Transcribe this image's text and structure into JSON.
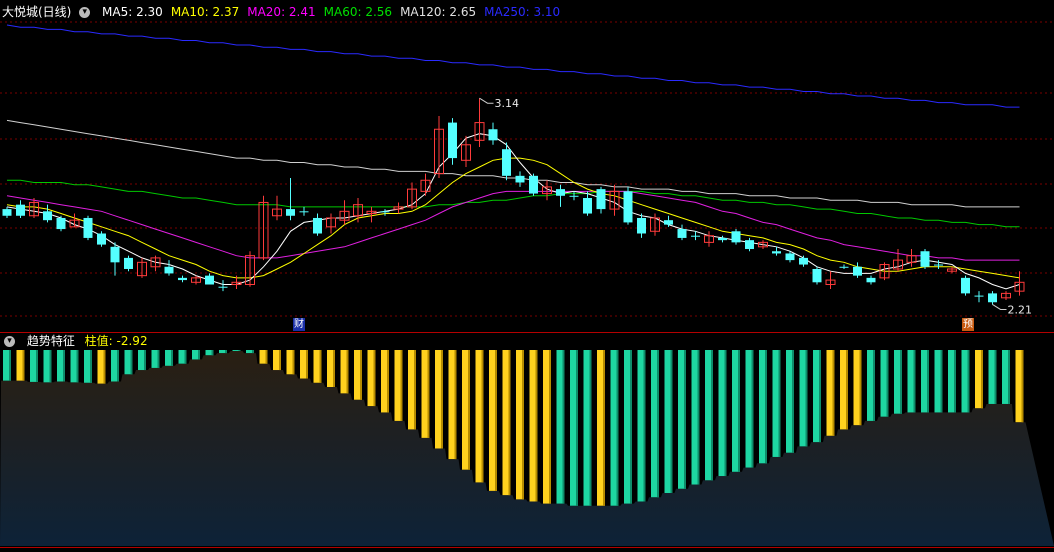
{
  "stock": {
    "title": "大悦城(日线)",
    "indicators": [
      {
        "label": "MA5: 2.30",
        "color": "#ffffff",
        "key": "ma5"
      },
      {
        "label": "MA10: 2.37",
        "color": "#ffff00",
        "key": "ma10"
      },
      {
        "label": "MA20: 2.41",
        "color": "#ff00ff",
        "key": "ma20"
      },
      {
        "label": "MA60: 2.56",
        "color": "#00e000",
        "key": "ma60"
      },
      {
        "label": "MA120: 2.65",
        "color": "#e0e0e0",
        "key": "ma120"
      },
      {
        "label": "MA250: 3.10",
        "color": "#2a2aff",
        "key": "ma250"
      }
    ],
    "high_label": "3.14",
    "low_label": "2.21",
    "badge_cai": "财",
    "badge_yu": "预"
  },
  "sub": {
    "title": "趋势特征",
    "value_label": "柱值: -2.92"
  },
  "chart_data": {
    "type": "candlestick",
    "y_range": [
      2.14,
      3.47
    ],
    "candles": [
      [
        2.64,
        2.61,
        2.65,
        2.6
      ],
      [
        2.66,
        2.61,
        2.68,
        2.6
      ],
      [
        2.61,
        2.67,
        2.69,
        2.6
      ],
      [
        2.63,
        2.59,
        2.66,
        2.58
      ],
      [
        2.6,
        2.55,
        2.61,
        2.54
      ],
      [
        2.56,
        2.59,
        2.62,
        2.56
      ],
      [
        2.6,
        2.51,
        2.61,
        2.5
      ],
      [
        2.53,
        2.48,
        2.54,
        2.47
      ],
      [
        2.47,
        2.4,
        2.49,
        2.34
      ],
      [
        2.42,
        2.37,
        2.43,
        2.36
      ],
      [
        2.34,
        2.4,
        2.42,
        2.33
      ],
      [
        2.38,
        2.42,
        2.43,
        2.36
      ],
      [
        2.38,
        2.35,
        2.41,
        2.34
      ],
      [
        2.33,
        2.32,
        2.34,
        2.31
      ],
      [
        2.31,
        2.33,
        2.34,
        2.3
      ],
      [
        2.34,
        2.3,
        2.35,
        2.3
      ],
      [
        2.29,
        2.29,
        2.32,
        2.27
      ],
      [
        2.3,
        2.31,
        2.34,
        2.28
      ],
      [
        2.3,
        2.43,
        2.45,
        2.29
      ],
      [
        2.42,
        2.67,
        2.7,
        2.41
      ],
      [
        2.61,
        2.64,
        2.7,
        2.59
      ],
      [
        2.64,
        2.61,
        2.78,
        2.59
      ],
      [
        2.63,
        2.63,
        2.65,
        2.61
      ],
      [
        2.6,
        2.53,
        2.62,
        2.52
      ],
      [
        2.56,
        2.6,
        2.62,
        2.53
      ],
      [
        2.59,
        2.63,
        2.68,
        2.57
      ],
      [
        2.61,
        2.66,
        2.69,
        2.58
      ],
      [
        2.62,
        2.63,
        2.65,
        2.58
      ],
      [
        2.63,
        2.63,
        2.64,
        2.61
      ],
      [
        2.64,
        2.65,
        2.67,
        2.62
      ],
      [
        2.65,
        2.73,
        2.76,
        2.64
      ],
      [
        2.72,
        2.77,
        2.8,
        2.7
      ],
      [
        2.8,
        3.0,
        3.06,
        2.78
      ],
      [
        3.03,
        2.87,
        3.05,
        2.84
      ],
      [
        2.86,
        2.93,
        2.97,
        2.83
      ],
      [
        2.95,
        3.03,
        3.14,
        2.92
      ],
      [
        3.0,
        2.95,
        3.03,
        2.93
      ],
      [
        2.91,
        2.79,
        2.94,
        2.77
      ],
      [
        2.79,
        2.76,
        2.81,
        2.74
      ],
      [
        2.79,
        2.71,
        2.8,
        2.7
      ],
      [
        2.71,
        2.74,
        2.77,
        2.68
      ],
      [
        2.73,
        2.7,
        2.75,
        2.65
      ],
      [
        2.7,
        2.7,
        2.72,
        2.68
      ],
      [
        2.69,
        2.62,
        2.72,
        2.61
      ],
      [
        2.73,
        2.64,
        2.74,
        2.62
      ],
      [
        2.64,
        2.72,
        2.75,
        2.61
      ],
      [
        2.72,
        2.58,
        2.74,
        2.57
      ],
      [
        2.6,
        2.53,
        2.62,
        2.51
      ],
      [
        2.54,
        2.6,
        2.62,
        2.52
      ],
      [
        2.59,
        2.57,
        2.61,
        2.56
      ],
      [
        2.55,
        2.51,
        2.57,
        2.5
      ],
      [
        2.52,
        2.52,
        2.54,
        2.5
      ],
      [
        2.49,
        2.52,
        2.54,
        2.47
      ],
      [
        2.51,
        2.5,
        2.52,
        2.49
      ],
      [
        2.54,
        2.49,
        2.55,
        2.48
      ],
      [
        2.5,
        2.46,
        2.51,
        2.45
      ],
      [
        2.47,
        2.49,
        2.5,
        2.46
      ],
      [
        2.45,
        2.44,
        2.47,
        2.43
      ],
      [
        2.44,
        2.41,
        2.45,
        2.4
      ],
      [
        2.42,
        2.39,
        2.43,
        2.38
      ],
      [
        2.37,
        2.31,
        2.38,
        2.3
      ],
      [
        2.3,
        2.32,
        2.36,
        2.28
      ],
      [
        2.38,
        2.38,
        2.39,
        2.37
      ],
      [
        2.38,
        2.34,
        2.4,
        2.33
      ],
      [
        2.33,
        2.31,
        2.34,
        2.3
      ],
      [
        2.33,
        2.39,
        2.4,
        2.32
      ],
      [
        2.37,
        2.41,
        2.46,
        2.36
      ],
      [
        2.4,
        2.43,
        2.46,
        2.38
      ],
      [
        2.45,
        2.38,
        2.46,
        2.37
      ],
      [
        2.39,
        2.39,
        2.41,
        2.37
      ],
      [
        2.36,
        2.37,
        2.38,
        2.35
      ],
      [
        2.33,
        2.26,
        2.34,
        2.25
      ],
      [
        2.25,
        2.25,
        2.27,
        2.22
      ],
      [
        2.26,
        2.22,
        2.27,
        2.21
      ],
      [
        2.24,
        2.26,
        2.27,
        2.23
      ],
      [
        2.27,
        2.31,
        2.36,
        2.25
      ]
    ],
    "ma5": [
      2.65,
      2.64,
      2.63,
      2.62,
      2.6,
      2.57,
      2.55,
      2.52,
      2.48,
      2.45,
      2.42,
      2.4,
      2.39,
      2.37,
      2.34,
      2.32,
      2.3,
      2.3,
      2.32,
      2.38,
      2.45,
      2.54,
      2.58,
      2.59,
      2.6,
      2.6,
      2.61,
      2.62,
      2.63,
      2.64,
      2.66,
      2.71,
      2.83,
      2.89,
      2.96,
      2.98,
      2.97,
      2.93,
      2.85,
      2.78,
      2.73,
      2.71,
      2.72,
      2.71,
      2.69,
      2.67,
      2.63,
      2.61,
      2.6,
      2.57,
      2.55,
      2.54,
      2.52,
      2.51,
      2.5,
      2.49,
      2.48,
      2.47,
      2.45,
      2.42,
      2.38,
      2.36,
      2.35,
      2.35,
      2.35,
      2.37,
      2.38,
      2.4,
      2.41,
      2.4,
      2.39,
      2.35,
      2.33,
      2.3,
      2.28,
      2.3
    ],
    "ma10": [
      2.66,
      2.65,
      2.65,
      2.64,
      2.62,
      2.6,
      2.58,
      2.56,
      2.54,
      2.52,
      2.49,
      2.46,
      2.43,
      2.41,
      2.39,
      2.36,
      2.34,
      2.33,
      2.33,
      2.34,
      2.37,
      2.4,
      2.44,
      2.48,
      2.52,
      2.57,
      2.6,
      2.61,
      2.62,
      2.62,
      2.63,
      2.66,
      2.71,
      2.76,
      2.8,
      2.83,
      2.86,
      2.87,
      2.87,
      2.86,
      2.84,
      2.8,
      2.76,
      2.73,
      2.71,
      2.7,
      2.68,
      2.66,
      2.64,
      2.62,
      2.6,
      2.58,
      2.56,
      2.54,
      2.53,
      2.52,
      2.51,
      2.49,
      2.48,
      2.46,
      2.43,
      2.41,
      2.4,
      2.38,
      2.37,
      2.36,
      2.36,
      2.37,
      2.38,
      2.38,
      2.38,
      2.37,
      2.36,
      2.35,
      2.34,
      2.33
    ],
    "ma20": [
      2.7,
      2.69,
      2.68,
      2.67,
      2.66,
      2.65,
      2.64,
      2.63,
      2.61,
      2.59,
      2.57,
      2.55,
      2.53,
      2.51,
      2.49,
      2.47,
      2.45,
      2.43,
      2.42,
      2.42,
      2.42,
      2.43,
      2.44,
      2.45,
      2.46,
      2.47,
      2.49,
      2.51,
      2.53,
      2.55,
      2.57,
      2.59,
      2.62,
      2.65,
      2.67,
      2.69,
      2.71,
      2.72,
      2.72,
      2.72,
      2.72,
      2.72,
      2.72,
      2.72,
      2.72,
      2.72,
      2.72,
      2.71,
      2.7,
      2.69,
      2.68,
      2.67,
      2.65,
      2.63,
      2.62,
      2.6,
      2.58,
      2.57,
      2.55,
      2.53,
      2.51,
      2.5,
      2.48,
      2.47,
      2.46,
      2.45,
      2.44,
      2.43,
      2.43,
      2.42,
      2.42,
      2.41,
      2.41,
      2.41,
      2.41,
      2.41
    ],
    "ma60": [
      2.77,
      2.77,
      2.76,
      2.76,
      2.76,
      2.75,
      2.75,
      2.74,
      2.73,
      2.72,
      2.72,
      2.71,
      2.7,
      2.69,
      2.69,
      2.68,
      2.67,
      2.66,
      2.66,
      2.66,
      2.66,
      2.65,
      2.65,
      2.65,
      2.65,
      2.65,
      2.65,
      2.65,
      2.65,
      2.65,
      2.65,
      2.65,
      2.66,
      2.66,
      2.67,
      2.67,
      2.68,
      2.68,
      2.69,
      2.7,
      2.7,
      2.71,
      2.71,
      2.71,
      2.72,
      2.72,
      2.72,
      2.72,
      2.71,
      2.71,
      2.7,
      2.7,
      2.69,
      2.68,
      2.68,
      2.67,
      2.67,
      2.66,
      2.66,
      2.65,
      2.64,
      2.64,
      2.63,
      2.62,
      2.62,
      2.61,
      2.6,
      2.6,
      2.59,
      2.59,
      2.58,
      2.58,
      2.57,
      2.57,
      2.56,
      2.56
    ],
    "ma120": [
      3.04,
      3.03,
      3.02,
      3.01,
      3.0,
      2.99,
      2.98,
      2.97,
      2.96,
      2.95,
      2.94,
      2.93,
      2.92,
      2.91,
      2.9,
      2.89,
      2.88,
      2.87,
      2.87,
      2.86,
      2.86,
      2.85,
      2.85,
      2.84,
      2.84,
      2.83,
      2.83,
      2.82,
      2.82,
      2.81,
      2.81,
      2.81,
      2.8,
      2.8,
      2.79,
      2.79,
      2.79,
      2.78,
      2.78,
      2.77,
      2.77,
      2.76,
      2.76,
      2.75,
      2.75,
      2.74,
      2.74,
      2.73,
      2.73,
      2.73,
      2.72,
      2.72,
      2.71,
      2.71,
      2.71,
      2.7,
      2.7,
      2.7,
      2.69,
      2.69,
      2.69,
      2.68,
      2.68,
      2.68,
      2.67,
      2.67,
      2.67,
      2.66,
      2.66,
      2.66,
      2.66,
      2.65,
      2.65,
      2.65,
      2.65,
      2.65
    ],
    "ma250": [
      3.47,
      3.46,
      3.46,
      3.45,
      3.45,
      3.44,
      3.44,
      3.43,
      3.43,
      3.42,
      3.42,
      3.41,
      3.41,
      3.4,
      3.4,
      3.39,
      3.39,
      3.38,
      3.38,
      3.37,
      3.37,
      3.36,
      3.36,
      3.35,
      3.35,
      3.34,
      3.34,
      3.33,
      3.33,
      3.32,
      3.32,
      3.31,
      3.31,
      3.3,
      3.3,
      3.29,
      3.29,
      3.28,
      3.28,
      3.27,
      3.27,
      3.26,
      3.26,
      3.25,
      3.25,
      3.24,
      3.24,
      3.23,
      3.23,
      3.22,
      3.22,
      3.21,
      3.21,
      3.2,
      3.2,
      3.19,
      3.19,
      3.18,
      3.18,
      3.17,
      3.17,
      3.16,
      3.16,
      3.15,
      3.15,
      3.14,
      3.14,
      3.13,
      3.13,
      3.12,
      3.12,
      3.11,
      3.11,
      3.11,
      3.1,
      3.1
    ],
    "histogram": {
      "values": [
        -3.9,
        -3.9,
        -3.87,
        -3.86,
        -3.88,
        -3.86,
        -3.85,
        -3.83,
        -3.88,
        -4.05,
        -4.15,
        -4.2,
        -4.25,
        -4.3,
        -4.4,
        -4.5,
        -4.55,
        -4.6,
        -4.55,
        -4.3,
        -4.15,
        -4.05,
        -3.95,
        -3.85,
        -3.75,
        -3.6,
        -3.45,
        -3.3,
        -3.15,
        -2.95,
        -2.75,
        -2.55,
        -2.3,
        -2.05,
        -1.8,
        -1.5,
        -1.3,
        -1.2,
        -1.1,
        -1.05,
        -1.0,
        -1.0,
        -0.95,
        -0.95,
        -0.95,
        -0.95,
        -1.0,
        -1.05,
        -1.15,
        -1.25,
        -1.35,
        -1.45,
        -1.55,
        -1.65,
        -1.75,
        -1.85,
        -1.95,
        -2.1,
        -2.2,
        -2.35,
        -2.45,
        -2.6,
        -2.75,
        -2.85,
        -2.95,
        -3.05,
        -3.12,
        -3.15,
        -3.15,
        -3.15,
        -3.15,
        -3.15,
        -3.25,
        -3.35,
        -3.35,
        -2.92
      ],
      "colors": [
        "c",
        "y",
        "c",
        "c",
        "c",
        "c",
        "c",
        "y",
        "c",
        "c",
        "c",
        "c",
        "c",
        "c",
        "c",
        "c",
        "c",
        "c",
        "c",
        "y",
        "y",
        "y",
        "y",
        "y",
        "y",
        "y",
        "y",
        "y",
        "y",
        "y",
        "y",
        "y",
        "y",
        "y",
        "y",
        "y",
        "y",
        "y",
        "y",
        "y",
        "y",
        "c",
        "c",
        "c",
        "y",
        "c",
        "c",
        "c",
        "c",
        "c",
        "c",
        "c",
        "c",
        "c",
        "c",
        "c",
        "c",
        "c",
        "c",
        "c",
        "c",
        "y",
        "y",
        "y",
        "c",
        "c",
        "c",
        "c",
        "c",
        "c",
        "c",
        "c",
        "y",
        "c",
        "c",
        "y"
      ]
    }
  }
}
